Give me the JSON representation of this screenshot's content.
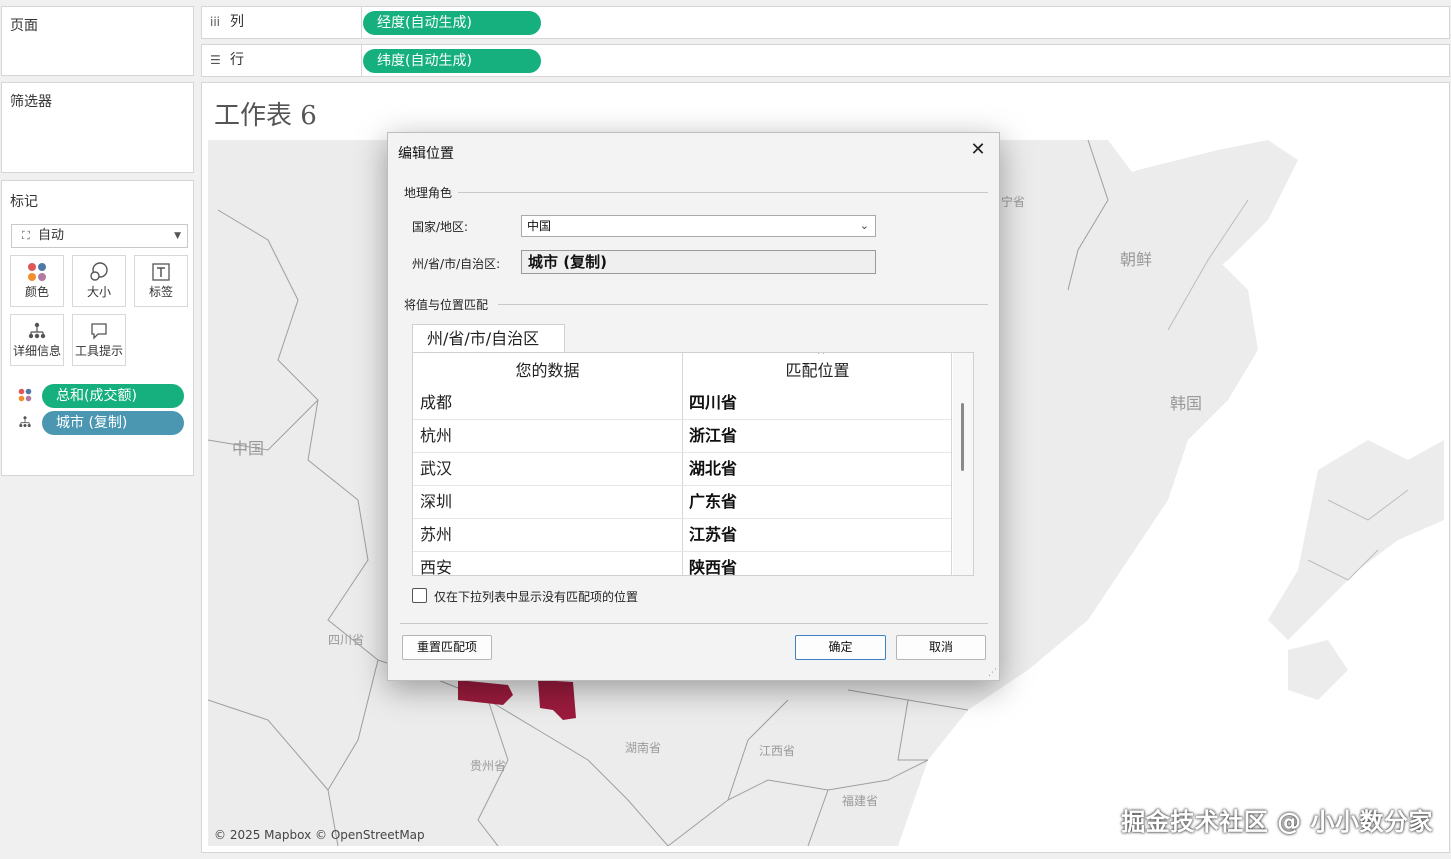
{
  "left_panel": {
    "pages_title": "页面",
    "filters_title": "筛选器",
    "marks_title": "标记",
    "mark_type": "自动",
    "mark_buttons": [
      {
        "icon": "color-dots-icon",
        "label": "颜色"
      },
      {
        "icon": "size-icon",
        "label": "大小"
      },
      {
        "icon": "label-T-icon",
        "label": "标签"
      },
      {
        "icon": "detail-icon",
        "label": "详细信息"
      },
      {
        "icon": "tooltip-icon",
        "label": "工具提示"
      }
    ],
    "mark_fields": [
      {
        "icon": "color-dots-icon",
        "label": "总和(成交额)",
        "color": "#15b07d"
      },
      {
        "icon": "detail-icon",
        "label": "城市 (复制)",
        "color": "#4b96b1"
      }
    ]
  },
  "shelves": {
    "columns_label": "列",
    "columns_pill": "经度(自动生成)",
    "rows_label": "行",
    "rows_pill": "纬度(自动生成)"
  },
  "worksheet": {
    "title": "工作表 6",
    "map_labels": {
      "china": "中国",
      "korea_north": "朝鲜",
      "korea_south": "韩国",
      "sichuan": "四川省",
      "hunan": "湖南省",
      "guizhou": "贵州省",
      "jiangxi": "江西省",
      "fujian": "福建省",
      "liaoning_partial": "宁省"
    },
    "credit": "© 2025 Mapbox © OpenStreetMap",
    "highlight_color": "#9b1b3d"
  },
  "dialog": {
    "title": "编辑位置",
    "geo_group": "地理角色",
    "country_label": "国家/地区:",
    "country_value": "中国",
    "state_label": "州/省/市/自治区:",
    "state_value": "城市 (复制)",
    "match_group": "将值与位置匹配",
    "tab_label": "州/省/市/自治区",
    "col_your_data": "您的数据",
    "col_match": "匹配位置",
    "rows": [
      {
        "data": "成都",
        "match": "四川省"
      },
      {
        "data": "杭州",
        "match": "浙江省"
      },
      {
        "data": "武汉",
        "match": "湖北省"
      },
      {
        "data": "深圳",
        "match": "广东省"
      },
      {
        "data": "苏州",
        "match": "江苏省"
      },
      {
        "data": "西安",
        "match": "陕西省"
      }
    ],
    "checkbox_label": "仅在下拉列表中显示没有匹配项的位置",
    "reset_button": "重置匹配项",
    "ok_button": "确定",
    "cancel_button": "取消"
  },
  "watermark": "掘金技术社区 @ 小小数分家"
}
